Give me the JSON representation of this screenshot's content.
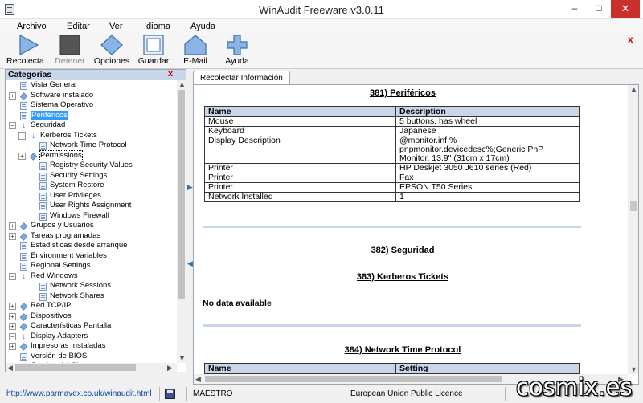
{
  "window": {
    "title": "WinAudit Freeware v3.0.11",
    "minimize": "–",
    "maximize": "□",
    "close": "✕"
  },
  "menu": [
    "Archivo",
    "Editar",
    "Ver",
    "Idioma",
    "Ayuda"
  ],
  "toolbar": {
    "items": [
      {
        "label": "Recolecta...",
        "icon": "play-icon",
        "enabled": true
      },
      {
        "label": "Detener",
        "icon": "stop-icon",
        "enabled": false
      },
      {
        "label": "Opciones",
        "icon": "diamond-icon",
        "enabled": true
      },
      {
        "label": "Guardar",
        "icon": "save-icon",
        "enabled": true
      },
      {
        "label": "E-Mail",
        "icon": "house-icon",
        "enabled": true
      },
      {
        "label": "Ayuda",
        "icon": "plus-icon",
        "enabled": true
      }
    ],
    "close": "x"
  },
  "categories": {
    "title": "Categorías",
    "close": "x",
    "items": [
      {
        "label": "Vista General",
        "level": 0,
        "icon": "doc",
        "expander": ""
      },
      {
        "label": "Software instalado",
        "level": 0,
        "icon": "diamond",
        "expander": "+"
      },
      {
        "label": "Sistema Operativo",
        "level": 0,
        "icon": "doc",
        "expander": ""
      },
      {
        "label": "Periféricos",
        "level": 0,
        "icon": "doc",
        "expander": "",
        "selected": true
      },
      {
        "label": "Seguridad",
        "level": 0,
        "icon": "arrow",
        "expander": "−"
      },
      {
        "label": "Kerberos Tickets",
        "level": 1,
        "icon": "arrow",
        "expander": "−"
      },
      {
        "label": "Network Time Protocol",
        "level": 2,
        "icon": "doc",
        "expander": ""
      },
      {
        "label": "Permissions",
        "level": 1,
        "icon": "diamond",
        "expander": "+",
        "focused": true
      },
      {
        "label": "Registry Security Values",
        "level": 2,
        "icon": "doc",
        "expander": ""
      },
      {
        "label": "Security Settings",
        "level": 2,
        "icon": "doc",
        "expander": ""
      },
      {
        "label": "System Restore",
        "level": 2,
        "icon": "doc",
        "expander": ""
      },
      {
        "label": "User Privileges",
        "level": 2,
        "icon": "doc",
        "expander": ""
      },
      {
        "label": "User Rights Assignment",
        "level": 2,
        "icon": "doc",
        "expander": ""
      },
      {
        "label": "Windows Firewall",
        "level": 2,
        "icon": "doc",
        "expander": ""
      },
      {
        "label": "Grupos y Usuarios",
        "level": 0,
        "icon": "diamond",
        "expander": "+"
      },
      {
        "label": "Tareas programadas",
        "level": 0,
        "icon": "diamond",
        "expander": "+"
      },
      {
        "label": "Estadísticas desde arranque",
        "level": 0,
        "icon": "doc",
        "expander": ""
      },
      {
        "label": "Environment Variables",
        "level": 0,
        "icon": "doc",
        "expander": ""
      },
      {
        "label": "Regional Settings",
        "level": 0,
        "icon": "doc",
        "expander": ""
      },
      {
        "label": "Red Windows",
        "level": 0,
        "icon": "arrow",
        "expander": "−"
      },
      {
        "label": "Network Sessions",
        "level": 2,
        "icon": "doc",
        "expander": ""
      },
      {
        "label": "Network Shares",
        "level": 2,
        "icon": "doc",
        "expander": ""
      },
      {
        "label": "Red TCP/IP",
        "level": 0,
        "icon": "diamond",
        "expander": "+"
      },
      {
        "label": "Dispositivos",
        "level": 0,
        "icon": "diamond",
        "expander": "+"
      },
      {
        "label": "Características Pantalla",
        "level": 0,
        "icon": "diamond",
        "expander": "+"
      },
      {
        "label": "Display Adapters",
        "level": 0,
        "icon": "arrow",
        "expander": "−"
      },
      {
        "label": "Impresoras Instaladas",
        "level": 0,
        "icon": "diamond",
        "expander": "+"
      },
      {
        "label": "Versión de BIOS",
        "level": 0,
        "icon": "doc",
        "expander": ""
      },
      {
        "label": "Gestión del Sistema",
        "level": 0,
        "icon": "diamond",
        "expander": "+"
      }
    ]
  },
  "tab": {
    "label": "Recolectar Información"
  },
  "report": {
    "section_381": "381) Periféricos",
    "table_381": {
      "headers": [
        "Name",
        "Description"
      ],
      "rows": [
        [
          "Mouse",
          "5 buttons, has wheel"
        ],
        [
          "Keyboard",
          "Japanese"
        ],
        [
          "Display Description",
          "@monitor.inf,%\npnpmonitor.devicedesc%;Generic PnP\nMonitor, 13.9\" (31cm x 17cm)"
        ],
        [
          "Printer",
          "HP Deskjet 3050 J610 series (Red)"
        ],
        [
          "Printer",
          "Fax"
        ],
        [
          "Printer",
          "EPSON T50 Series"
        ],
        [
          "Network Installed",
          "1"
        ]
      ]
    },
    "section_382": "382) Seguridad",
    "section_383": "383) Kerberos Tickets",
    "no_data": "No data available",
    "section_384": "384) Network Time Protocol",
    "table_384": {
      "headers": [
        "Name",
        "Setting"
      ]
    }
  },
  "statusbar": {
    "link": "http://www.parmavex.co.uk/winaudit.html",
    "computer": "MAESTRO",
    "licence": "European Union Public Licence"
  },
  "watermark": "cosmix.es",
  "colors": {
    "header_bg": "#c9d6ea",
    "selection": "#3399ff",
    "close_red": "#c7302b"
  }
}
